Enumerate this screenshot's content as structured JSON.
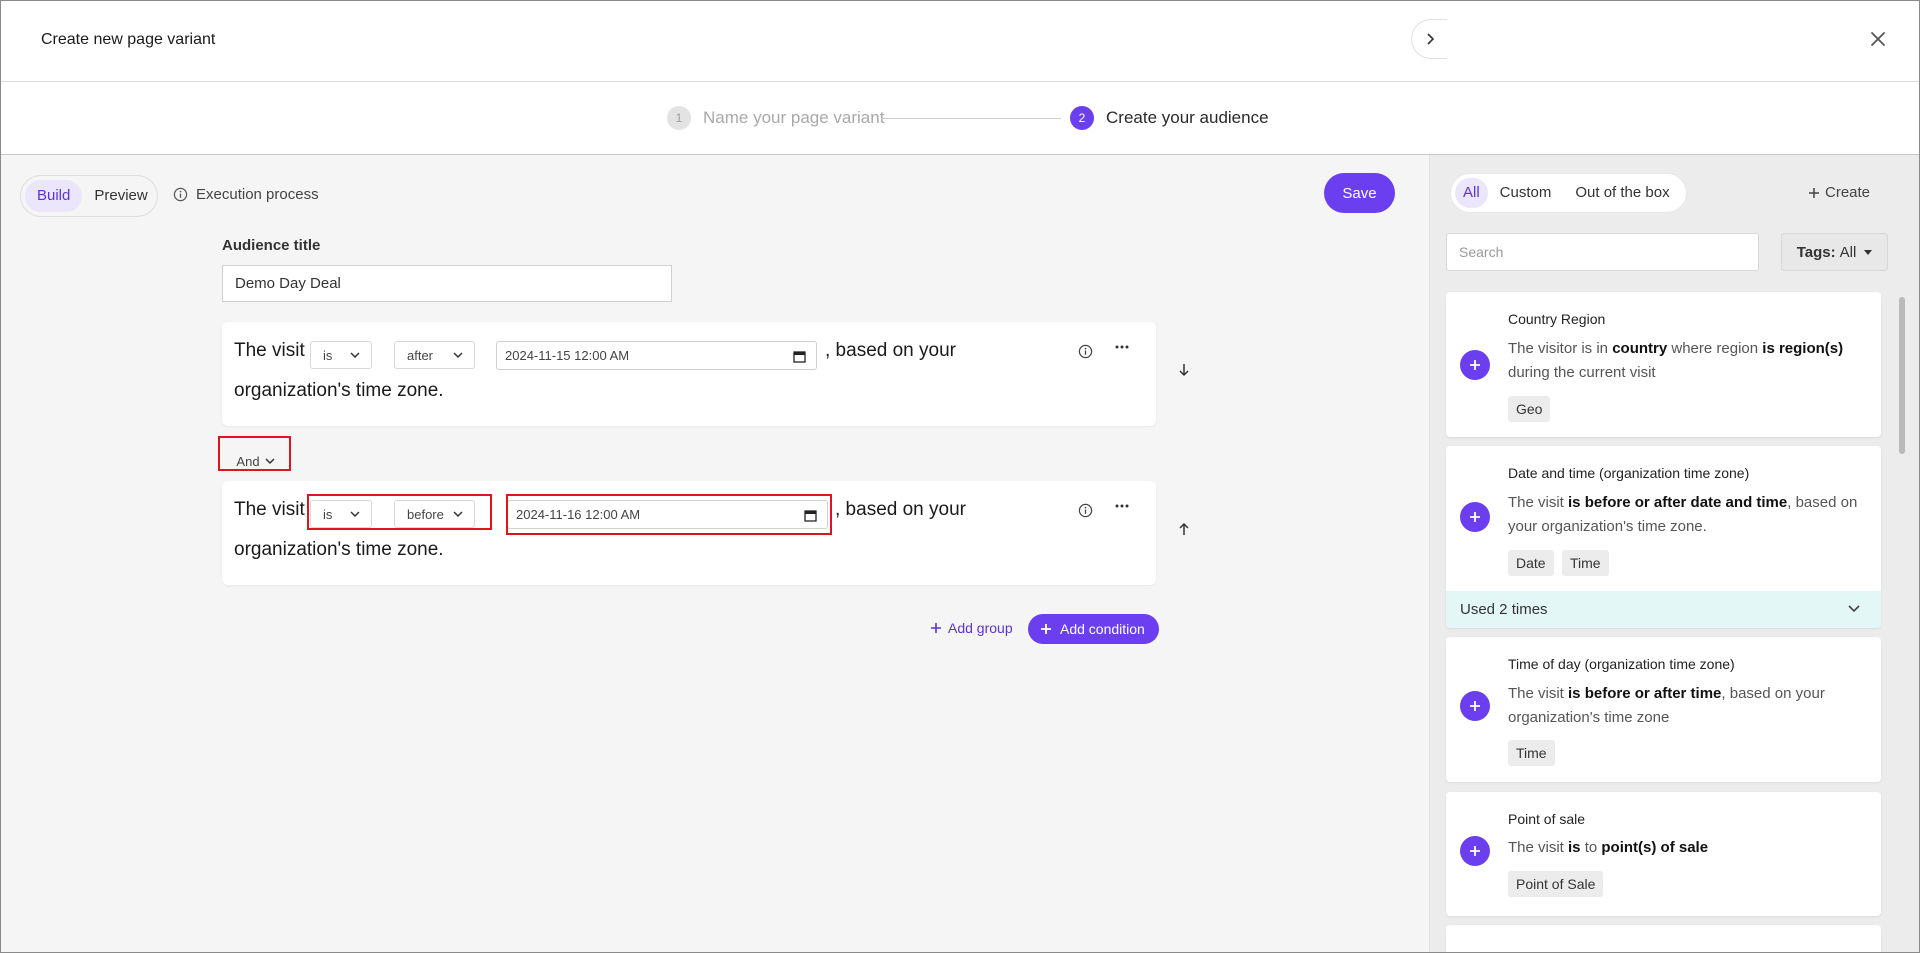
{
  "header": {
    "title": "Create new page variant"
  },
  "stepper": {
    "step1": {
      "num": "1",
      "label": "Name your page variant"
    },
    "step2": {
      "num": "2",
      "label": "Create your audience"
    }
  },
  "toolbar": {
    "build": "Build",
    "preview": "Preview",
    "execution": "Execution process",
    "save": "Save"
  },
  "audience": {
    "label": "Audience title",
    "value": "Demo Day Deal"
  },
  "conditions": [
    {
      "prefix": "The visit",
      "op": "is",
      "mode": "after",
      "datetime": "2024-11-15 12:00  AM",
      "suffix": ", based on your",
      "line2": "organization's time zone."
    },
    {
      "prefix": "The visit",
      "op": "is",
      "mode": "before",
      "datetime": "2024-11-16 12:00  AM",
      "suffix": ", based on your",
      "line2": "organization's time zone."
    }
  ],
  "joiner": "And",
  "actions": {
    "add_group": "Add group",
    "add_condition": "Add condition"
  },
  "panel": {
    "filters": [
      "All",
      "Custom",
      "Out of the box"
    ],
    "create": "Create",
    "search_placeholder": "Search",
    "tags_label": "Tags:",
    "tags_value": "All",
    "cards": [
      {
        "title": "Country Region",
        "desc_html": "The visitor is in <b>country</b> where region <b>is region(s)</b> during the current visit",
        "tags": [
          "Geo"
        ]
      },
      {
        "title": "Date and time (organization time zone)",
        "desc_html": "The visit <b>is before or after date and time</b>, based on your organization's time zone.",
        "tags": [
          "Date",
          "Time"
        ]
      },
      {
        "title": "Time of day (organization time zone)",
        "desc_html": "The visit <b>is before or after time</b>, based on your organization's time zone",
        "tags": [
          "Time"
        ]
      },
      {
        "title": "Point of sale",
        "desc_html": "The visit <b>is</b> to <b>point(s) of sale</b>",
        "tags": [
          "Point of Sale"
        ]
      }
    ],
    "used": "Used 2 times"
  },
  "colors": {
    "accent": "#6b3ff0",
    "highlight": "#e0141e"
  }
}
